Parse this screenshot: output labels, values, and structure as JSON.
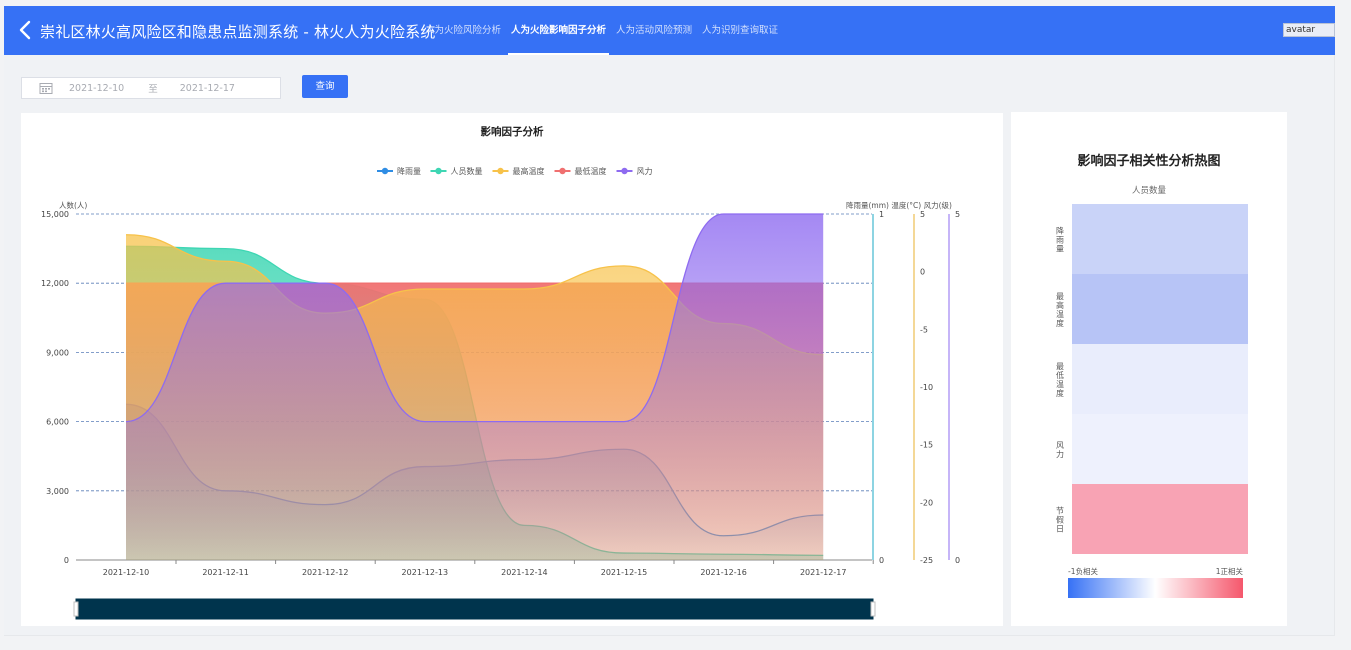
{
  "header": {
    "title": "崇礼区林火高风险区和隐患点监测系统 - 林火人为火险系统",
    "tabs": [
      {
        "label": "人为火险风险分析",
        "active": false
      },
      {
        "label": "人为火险影响因子分析",
        "active": true
      },
      {
        "label": "人为活动风险预测",
        "active": false
      },
      {
        "label": "人为识别查询取证",
        "active": false
      }
    ],
    "avatar_alt": "avatar"
  },
  "filter": {
    "start_date": "2021-12-10",
    "separator": "至",
    "end_date": "2021-12-17",
    "query_label": "查询"
  },
  "colors": {
    "accent": "#3671f5",
    "rain": "#2f8de4",
    "people": "#3ed6b3",
    "maxtemp": "#f7c24a",
    "mintemp": "#f07070",
    "wind": "#8e6bf0"
  },
  "chart_data": [
    {
      "type": "line",
      "title": "影响因子分析",
      "legend": [
        "降雨量",
        "人员数量",
        "最高温度",
        "最低温度",
        "风力"
      ],
      "legend_placement": "top-center",
      "x": [
        "2021-12-10",
        "2021-12-11",
        "2021-12-12",
        "2021-12-13",
        "2021-12-14",
        "2021-12-15",
        "2021-12-16",
        "2021-12-17"
      ],
      "y_left": {
        "label": "人数(人)",
        "ticks": [
          "15,000",
          "12,000",
          "9,000",
          "6,000",
          "3,000",
          "0"
        ],
        "min": 0,
        "max": 15000
      },
      "y_right_labels": "降雨量(mm) 温度(°C) 风力(级)",
      "y_rain": {
        "ticks": [
          "1",
          "0"
        ],
        "min": 0,
        "max": 1
      },
      "y_temp": {
        "ticks": [
          "5",
          "0",
          "-5",
          "-10",
          "-15",
          "-20",
          "-25"
        ],
        "min": -25,
        "max": 5
      },
      "y_wind": {
        "ticks": [
          "5",
          "0"
        ],
        "min": 0,
        "max": 5
      },
      "grid": true,
      "series": [
        {
          "name": "降雨量",
          "axis": "rain",
          "values": [
            0.45,
            0.2,
            0.16,
            0.27,
            0.29,
            0.32,
            0.07,
            0.13
          ]
        },
        {
          "name": "人员数量",
          "axis": "left",
          "values": [
            13600,
            13500,
            12000,
            11300,
            1500,
            300,
            250,
            200
          ]
        },
        {
          "name": "最高温度",
          "axis": "temp",
          "values": [
            3.2,
            0.9,
            -3.6,
            -1.5,
            -1.5,
            0.5,
            -4.5,
            -7.2
          ]
        },
        {
          "name": "最低温度",
          "axis": "temp",
          "values": [
            -1.0,
            -1.0,
            -1.0,
            -1.0,
            -1.0,
            -1.0,
            -1.0,
            -1.0
          ]
        },
        {
          "name": "风力",
          "axis": "wind",
          "values": [
            2.0,
            4.0,
            4.0,
            2.0,
            2.0,
            2.0,
            5.0,
            5.0
          ]
        }
      ]
    },
    {
      "type": "heatmap",
      "title": "影响因子相关性分析热图",
      "x_label": "人员数量",
      "rows": [
        "降雨量",
        "最高温度",
        "最低温度",
        "风力",
        "节假日"
      ],
      "values": [
        -0.25,
        -0.35,
        -0.1,
        -0.06,
        0.45
      ],
      "cell_colors": [
        "#c9d3f8",
        "#b7c4f6",
        "#e9edfc",
        "#eef1fd",
        "#f8a3b4"
      ],
      "visual_map": {
        "min_label": "-1负相关",
        "max_label": "1正相关"
      }
    }
  ]
}
